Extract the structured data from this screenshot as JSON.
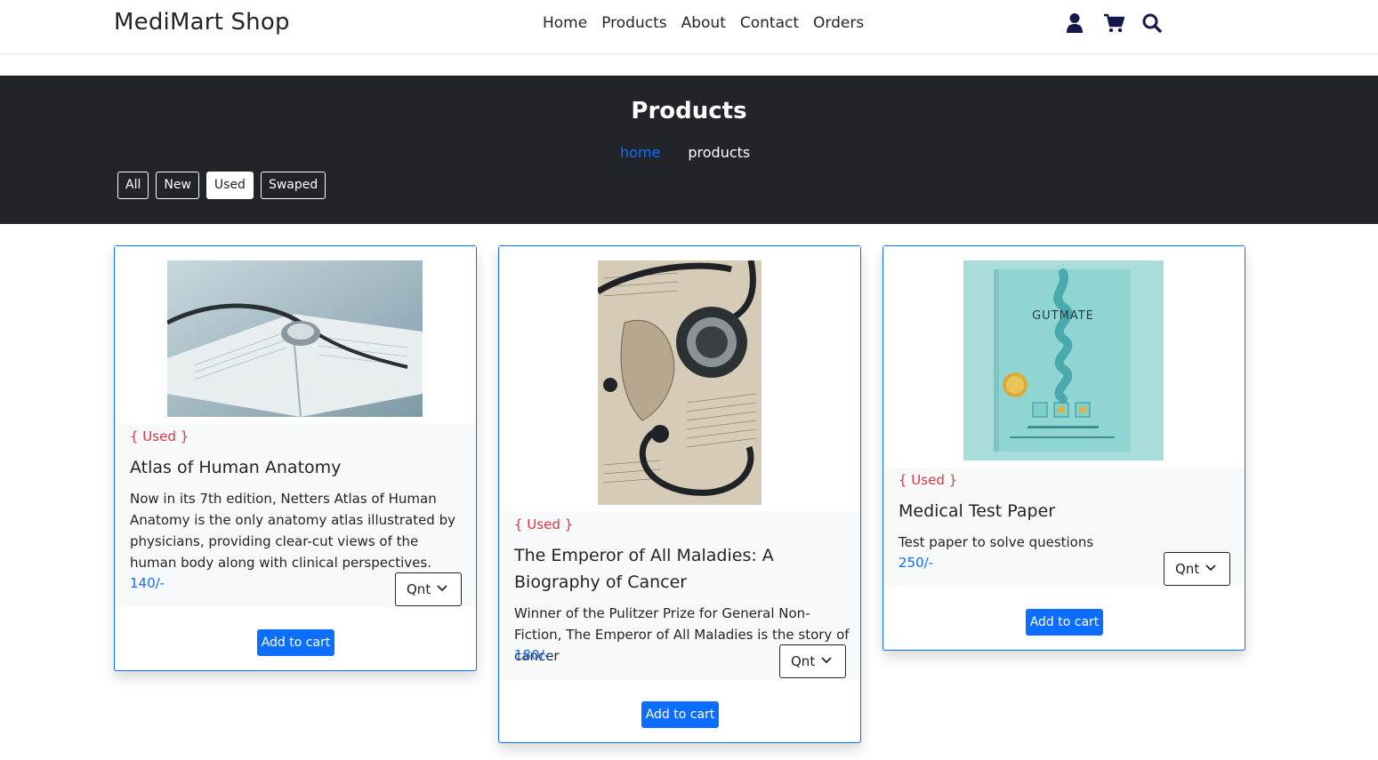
{
  "brand": "MediMart Shop",
  "nav": {
    "items": [
      "Home",
      "Products",
      "About",
      "Contact",
      "Orders"
    ],
    "icons": [
      "user-icon",
      "cart-icon",
      "search-icon"
    ]
  },
  "hero": {
    "title": "Products",
    "breadcrumb": {
      "home": "home",
      "current": "products"
    },
    "filters": [
      {
        "label": "All",
        "active": false
      },
      {
        "label": "New",
        "active": false
      },
      {
        "label": "Used",
        "active": true
      },
      {
        "label": "Swaped",
        "active": false
      }
    ]
  },
  "products": [
    {
      "tag": "{ Used }",
      "title": "Atlas of Human Anatomy",
      "description": "Now in its 7th edition, Netters Atlas of Human Anatomy is the only anatomy atlas illustrated by physicians, providing clear-cut views of the human body along with clinical perspectives.",
      "price": "140/-",
      "qty_label": "Qnt",
      "button": "Add to cart"
    },
    {
      "tag": "{ Used }",
      "title": "The Emperor of All Maladies: A Biography of Cancer",
      "description": "Winner of the Pulitzer Prize for General Non-Fiction, The Emperor of All Maladies is the story of cancer",
      "price": "180/-",
      "qty_label": "Qnt",
      "button": "Add to cart"
    },
    {
      "tag": "{ Used }",
      "title": "Medical Test Paper",
      "description": "Test paper to solve questions",
      "price": "250/-",
      "qty_label": "Qnt",
      "button": "Add to cart",
      "cover_text": "GUTMATE"
    }
  ],
  "colors": {
    "primary": "#0d6efd",
    "dark": "#212529",
    "danger": "#dc3545",
    "light": "#f8f9fa"
  }
}
